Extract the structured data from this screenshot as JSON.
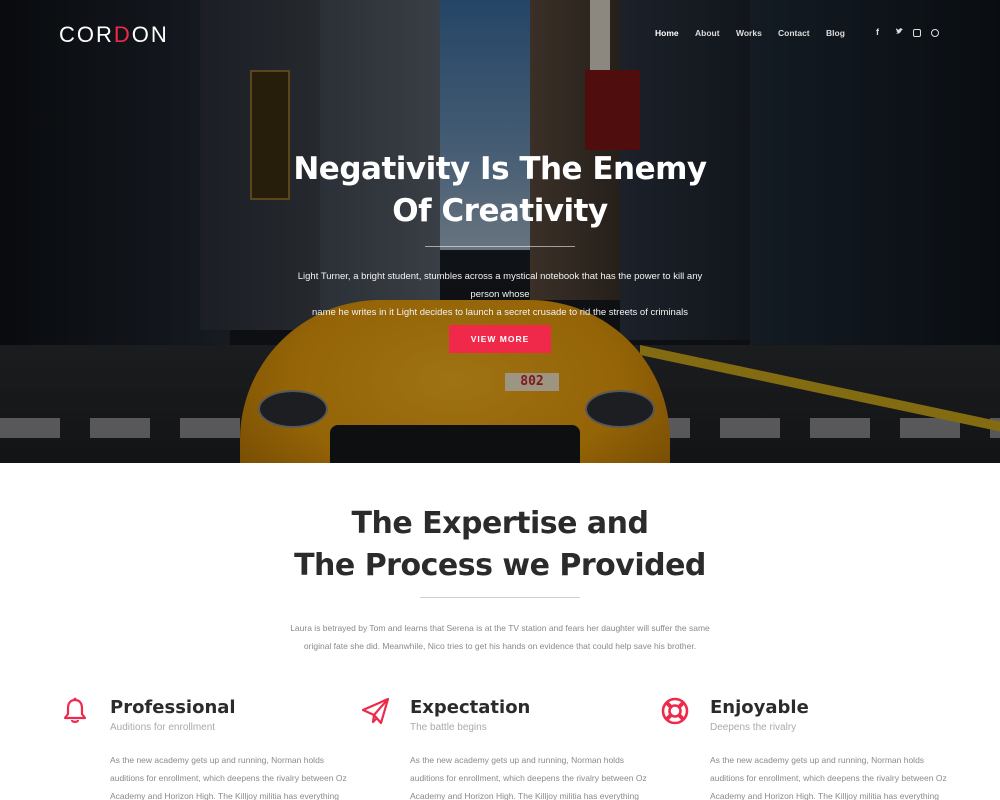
{
  "brand": {
    "logo": "CORDON",
    "logo_accent": "D",
    "accent_color": "#f0284a"
  },
  "nav": {
    "items": [
      {
        "label": "Home",
        "active": true
      },
      {
        "label": "About"
      },
      {
        "label": "Works"
      },
      {
        "label": "Contact"
      },
      {
        "label": "Blog"
      }
    ]
  },
  "social": {
    "icons": [
      "facebook-icon",
      "twitter-icon",
      "instagram-icon",
      "pinterest-icon"
    ],
    "facebook": "f",
    "twitter": "t"
  },
  "hero": {
    "title_line1": "Negativity Is The Enemy",
    "title_line2": "Of Creativity",
    "text_line1": "Light Turner, a bright student, stumbles across a mystical notebook that has the power to kill any person whose",
    "text_line2": "name he writes in it Light decides to launch a secret crusade to rid the streets of criminals",
    "button": "VIEW MORE",
    "taxi_number": "802"
  },
  "expertise": {
    "title_line1": "The Expertise and",
    "title_line2": "The Process we Provided",
    "text_line1": "Laura is betrayed by Tom and learns that Serena is at the TV station and fears her daughter will suffer the same",
    "text_line2": "original fate she did. Meanwhile, Nico tries to get his hands on evidence that could help save his brother."
  },
  "features": [
    {
      "icon": "bell-icon",
      "title": "Professional",
      "subtitle": "Auditions for enrollment",
      "body_line1": "As the new academy gets up and running, Norman holds",
      "body_line2": "auditions for enrollment, which deepens the rivalry between Oz",
      "body_line3": "Academy and Horizon High. The Killjoy militia has everything"
    },
    {
      "icon": "paper-plane-icon",
      "title": "Expectation",
      "subtitle": "The battle begins",
      "body_line1": "As the new academy gets up and running, Norman holds",
      "body_line2": "auditions for enrollment, which deepens the rivalry between Oz",
      "body_line3": "Academy and Horizon High. The Killjoy militia has everything"
    },
    {
      "icon": "lifebuoy-icon",
      "title": "Enjoyable",
      "subtitle": "Deepens the rivalry",
      "body_line1": "As the new academy gets up and running, Norman holds",
      "body_line2": "auditions for enrollment, which deepens the rivalry between Oz",
      "body_line3": "Academy and Horizon High. The Killjoy militia has everything"
    }
  ]
}
